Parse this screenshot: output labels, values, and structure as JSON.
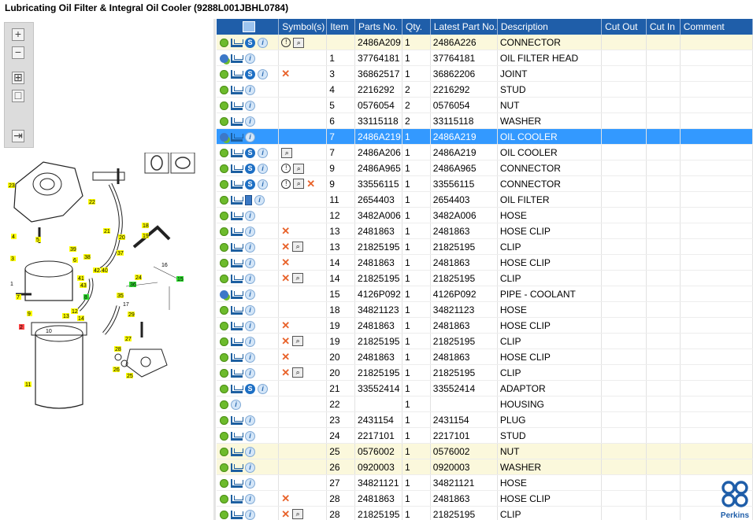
{
  "window": {
    "title": "Lubricating Oil Filter & Integral Oil Cooler (9288L001JBHL0784)"
  },
  "toolbar": {
    "buttons": [
      {
        "name": "zoom-in",
        "glyph": "+"
      },
      {
        "name": "zoom-out",
        "glyph": "−"
      },
      {
        "name": "fit-all",
        "glyph": "⊞"
      },
      {
        "name": "fit-window",
        "glyph": "□"
      },
      {
        "name": "export",
        "glyph": "⇥"
      }
    ]
  },
  "diagram": {
    "callouts": [
      "23",
      "22",
      "21",
      "18",
      "19",
      "20",
      "4",
      "5",
      "3",
      "39",
      "38",
      "6",
      "37",
      "41",
      "42",
      "40",
      "24",
      "43",
      "35",
      "16",
      "15",
      "17",
      "1",
      "7",
      "8",
      "9",
      "2",
      "12",
      "13",
      "14",
      "29",
      "28",
      "27",
      "10",
      "11",
      "26",
      "25",
      "36"
    ]
  },
  "table": {
    "columns": [
      "",
      "Symbol(s)",
      "Item",
      "Parts No.",
      "Qty.",
      "Latest Part No.",
      "Description",
      "Cut Out",
      "Cut In",
      "Comment"
    ],
    "rows": [
      {
        "icons": "gear,cart,s,i",
        "sym": "bubble,mag",
        "item": "",
        "part": "2486A209",
        "qty": "1",
        "latest": "2486A226",
        "desc": "CONNECTOR",
        "state": "hl"
      },
      {
        "icons": "gear2,cart,i",
        "sym": "",
        "item": "1",
        "part": "37764181",
        "qty": "1",
        "latest": "37764181",
        "desc": "OIL FILTER HEAD",
        "state": ""
      },
      {
        "icons": "gear,cart,s,i",
        "sym": "x",
        "item": "3",
        "part": "36862517",
        "qty": "1",
        "latest": "36862206",
        "desc": "JOINT",
        "state": ""
      },
      {
        "icons": "gear,cart,i",
        "sym": "",
        "item": "4",
        "part": "2216292",
        "qty": "2",
        "latest": "2216292",
        "desc": "STUD",
        "state": ""
      },
      {
        "icons": "gear,cart,i",
        "sym": "",
        "item": "5",
        "part": "0576054",
        "qty": "2",
        "latest": "0576054",
        "desc": "NUT",
        "state": ""
      },
      {
        "icons": "gear,cart,i",
        "sym": "",
        "item": "6",
        "part": "33115118",
        "qty": "2",
        "latest": "33115118",
        "desc": "WASHER",
        "state": ""
      },
      {
        "icons": "gear2,cart,i",
        "sym": "",
        "item": "7",
        "part": "2486A219",
        "qty": "1",
        "latest": "2486A219",
        "desc": "OIL COOLER",
        "state": "sel"
      },
      {
        "icons": "gear,cart,s,i",
        "sym": "mag",
        "item": "7",
        "part": "2486A206",
        "qty": "1",
        "latest": "2486A219",
        "desc": "OIL COOLER",
        "state": ""
      },
      {
        "icons": "gear,cart,s,i",
        "sym": "bubble,mag",
        "item": "9",
        "part": "2486A965",
        "qty": "1",
        "latest": "2486A965",
        "desc": "CONNECTOR",
        "state": ""
      },
      {
        "icons": "gear,cart,s,i",
        "sym": "bubble,mag,x",
        "item": "9",
        "part": "33556115",
        "qty": "1",
        "latest": "33556115",
        "desc": "CONNECTOR",
        "state": ""
      },
      {
        "icons": "gear,cart,book,i",
        "sym": "",
        "item": "11",
        "part": "2654403",
        "qty": "1",
        "latest": "2654403",
        "desc": "OIL FILTER",
        "state": ""
      },
      {
        "icons": "gear,cart,i",
        "sym": "",
        "item": "12",
        "part": "3482A006",
        "qty": "1",
        "latest": "3482A006",
        "desc": "HOSE",
        "state": ""
      },
      {
        "icons": "gear,cart,i",
        "sym": "x",
        "item": "13",
        "part": "2481863",
        "qty": "1",
        "latest": "2481863",
        "desc": "HOSE CLIP",
        "state": ""
      },
      {
        "icons": "gear,cart,i",
        "sym": "x,mag",
        "item": "13",
        "part": "21825195",
        "qty": "1",
        "latest": "21825195",
        "desc": "CLIP",
        "state": ""
      },
      {
        "icons": "gear,cart,i",
        "sym": "x",
        "item": "14",
        "part": "2481863",
        "qty": "1",
        "latest": "2481863",
        "desc": "HOSE CLIP",
        "state": ""
      },
      {
        "icons": "gear,cart,i",
        "sym": "x,mag",
        "item": "14",
        "part": "21825195",
        "qty": "1",
        "latest": "21825195",
        "desc": "CLIP",
        "state": ""
      },
      {
        "icons": "gear2,cart,i",
        "sym": "",
        "item": "15",
        "part": "4126P092",
        "qty": "1",
        "latest": "4126P092",
        "desc": "PIPE - COOLANT",
        "state": ""
      },
      {
        "icons": "gear,cart,i",
        "sym": "",
        "item": "18",
        "part": "34821123",
        "qty": "1",
        "latest": "34821123",
        "desc": "HOSE",
        "state": ""
      },
      {
        "icons": "gear,cart,i",
        "sym": "x",
        "item": "19",
        "part": "2481863",
        "qty": "1",
        "latest": "2481863",
        "desc": "HOSE CLIP",
        "state": ""
      },
      {
        "icons": "gear,cart,i",
        "sym": "x,mag",
        "item": "19",
        "part": "21825195",
        "qty": "1",
        "latest": "21825195",
        "desc": "CLIP",
        "state": ""
      },
      {
        "icons": "gear,cart,i",
        "sym": "x",
        "item": "20",
        "part": "2481863",
        "qty": "1",
        "latest": "2481863",
        "desc": "HOSE CLIP",
        "state": ""
      },
      {
        "icons": "gear,cart,i",
        "sym": "x,mag",
        "item": "20",
        "part": "21825195",
        "qty": "1",
        "latest": "21825195",
        "desc": "CLIP",
        "state": ""
      },
      {
        "icons": "gear,cart,s,i",
        "sym": "",
        "item": "21",
        "part": "33552414",
        "qty": "1",
        "latest": "33552414",
        "desc": "ADAPTOR",
        "state": ""
      },
      {
        "icons": "gear,i",
        "sym": "",
        "item": "22",
        "part": "",
        "qty": "1",
        "latest": "",
        "desc": "HOUSING",
        "state": ""
      },
      {
        "icons": "gear,cart,i",
        "sym": "",
        "item": "23",
        "part": "2431154",
        "qty": "1",
        "latest": "2431154",
        "desc": "PLUG",
        "state": ""
      },
      {
        "icons": "gear,cart,i",
        "sym": "",
        "item": "24",
        "part": "2217101",
        "qty": "1",
        "latest": "2217101",
        "desc": "STUD",
        "state": ""
      },
      {
        "icons": "gear,cart,i",
        "sym": "",
        "item": "25",
        "part": "0576002",
        "qty": "1",
        "latest": "0576002",
        "desc": "NUT",
        "state": "hl"
      },
      {
        "icons": "gear,cart,i",
        "sym": "",
        "item": "26",
        "part": "0920003",
        "qty": "1",
        "latest": "0920003",
        "desc": "WASHER",
        "state": "hl"
      },
      {
        "icons": "gear,cart,i",
        "sym": "",
        "item": "27",
        "part": "34821121",
        "qty": "1",
        "latest": "34821121",
        "desc": "HOSE",
        "state": ""
      },
      {
        "icons": "gear,cart,i",
        "sym": "x",
        "item": "28",
        "part": "2481863",
        "qty": "1",
        "latest": "2481863",
        "desc": "HOSE CLIP",
        "state": ""
      },
      {
        "icons": "gear,cart,i",
        "sym": "x,mag",
        "item": "28",
        "part": "21825195",
        "qty": "1",
        "latest": "21825195",
        "desc": "CLIP",
        "state": ""
      }
    ]
  },
  "brand": {
    "name": "Perkins",
    "color": "#1f5ea9"
  },
  "colors": {
    "header": "#1f5ea9",
    "selected": "#3399ff",
    "highlight": "#fbf8dc",
    "callout": "#ffff00",
    "callout_green": "#33dd33"
  }
}
